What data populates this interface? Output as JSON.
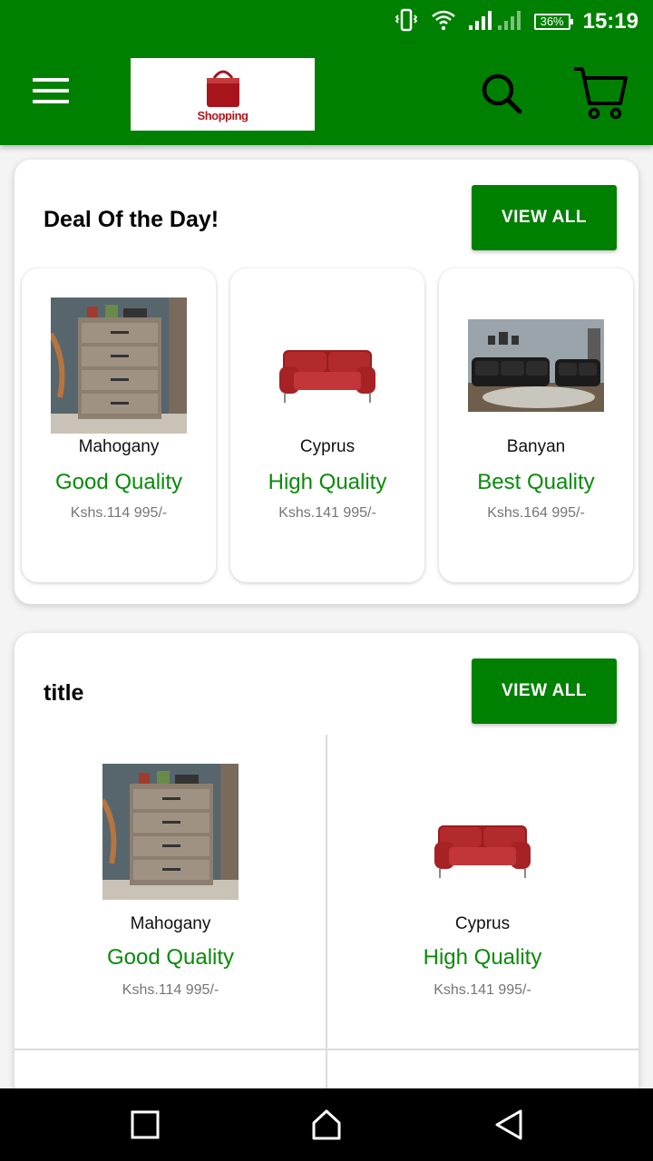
{
  "status": {
    "battery": "36%",
    "time": "15:19"
  },
  "toolbar": {
    "logo_text": "Shopping"
  },
  "deals": {
    "title": "Deal Of the Day!",
    "view_all": "VIEW ALL",
    "items": [
      {
        "name": "Mahogany",
        "quality": "Good Quality",
        "price": "Kshs.114 995/-"
      },
      {
        "name": "Cyprus",
        "quality": "High Quality",
        "price": "Kshs.141 995/-"
      },
      {
        "name": "Banyan",
        "quality": "Best Quality",
        "price": "Kshs.164 995/-"
      }
    ]
  },
  "section2": {
    "title": "title",
    "view_all": "VIEW ALL",
    "items": [
      {
        "name": "Mahogany",
        "quality": "Good Quality",
        "price": "Kshs.114 995/-"
      },
      {
        "name": "Cyprus",
        "quality": "High Quality",
        "price": "Kshs.141 995/-"
      }
    ]
  },
  "colors": {
    "primary": "#008000",
    "quality_text": "#0a8a0a",
    "price_text": "#757575"
  },
  "icons": [
    "vibrate-icon",
    "wifi-icon",
    "signal-icon",
    "battery-icon",
    "menu-icon",
    "search-icon",
    "cart-icon",
    "recents-icon",
    "home-icon",
    "back-icon"
  ]
}
